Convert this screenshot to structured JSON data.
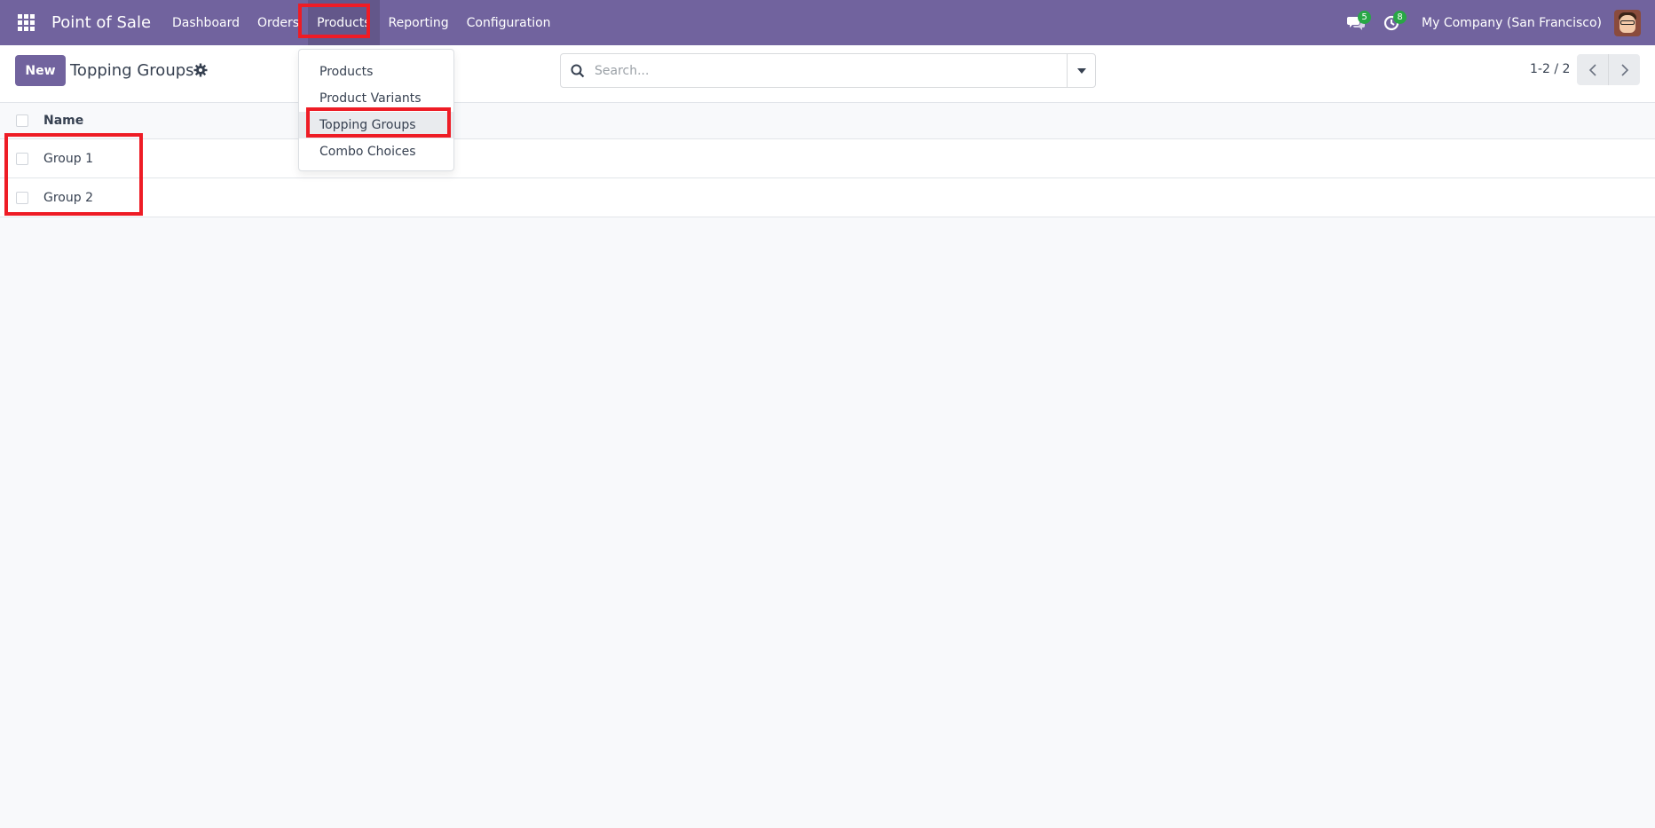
{
  "navbar": {
    "app_name": "Point of Sale",
    "menu": [
      {
        "label": "Dashboard"
      },
      {
        "label": "Orders"
      },
      {
        "label": "Products"
      },
      {
        "label": "Reporting"
      },
      {
        "label": "Configuration"
      }
    ],
    "messages_count": "5",
    "activities_count": "8",
    "company": "My Company (San Francisco)",
    "color": "#71639e"
  },
  "control_panel": {
    "new_label": "New",
    "breadcrumb": "Topping Groups",
    "search_placeholder": "Search...",
    "pager": "1-2 / 2"
  },
  "dropdown": {
    "items": [
      {
        "label": "Products"
      },
      {
        "label": "Product Variants"
      },
      {
        "label": "Topping Groups"
      },
      {
        "label": "Combo Choices"
      }
    ]
  },
  "list": {
    "header": {
      "name": "Name"
    },
    "rows": [
      {
        "name": "Group 1"
      },
      {
        "name": "Group 2"
      }
    ]
  },
  "highlight_color": "#ee1c25"
}
